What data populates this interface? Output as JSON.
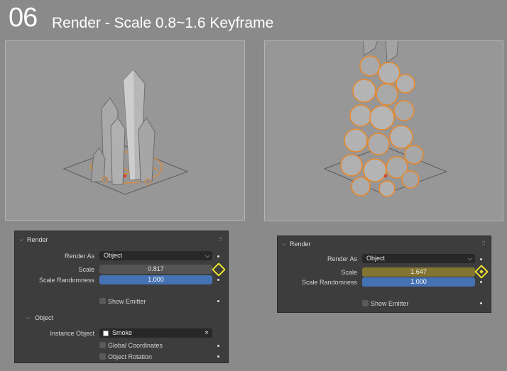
{
  "header": {
    "number": "06",
    "title": "Render - Scale 0.8~1.6 Keyframe"
  },
  "left_panel": {
    "section": "Render",
    "render_as_label": "Render As",
    "render_as_value": "Object",
    "scale_label": "Scale",
    "scale_value": "0.817",
    "scale_random_label": "Scale Randomness",
    "scale_random_value": "1.000",
    "show_emitter": "Show Emitter",
    "object_section": "Object",
    "instance_label": "Instance Object",
    "instance_value": "Smoke",
    "global_coords": "Global Coordinates",
    "object_rotation": "Object Rotation"
  },
  "right_panel": {
    "section": "Render",
    "render_as_label": "Render As",
    "render_as_value": "Object",
    "scale_label": "Scale",
    "scale_value": "1.647",
    "scale_random_label": "Scale Randomness",
    "scale_random_value": "1.000",
    "show_emitter": "Show Emitter"
  },
  "colors": {
    "keyframe_highlight": "#f2e52a",
    "keyed_field": "#827531",
    "selection_outline": "#e8892b",
    "slider_blue": "#4572b3"
  }
}
